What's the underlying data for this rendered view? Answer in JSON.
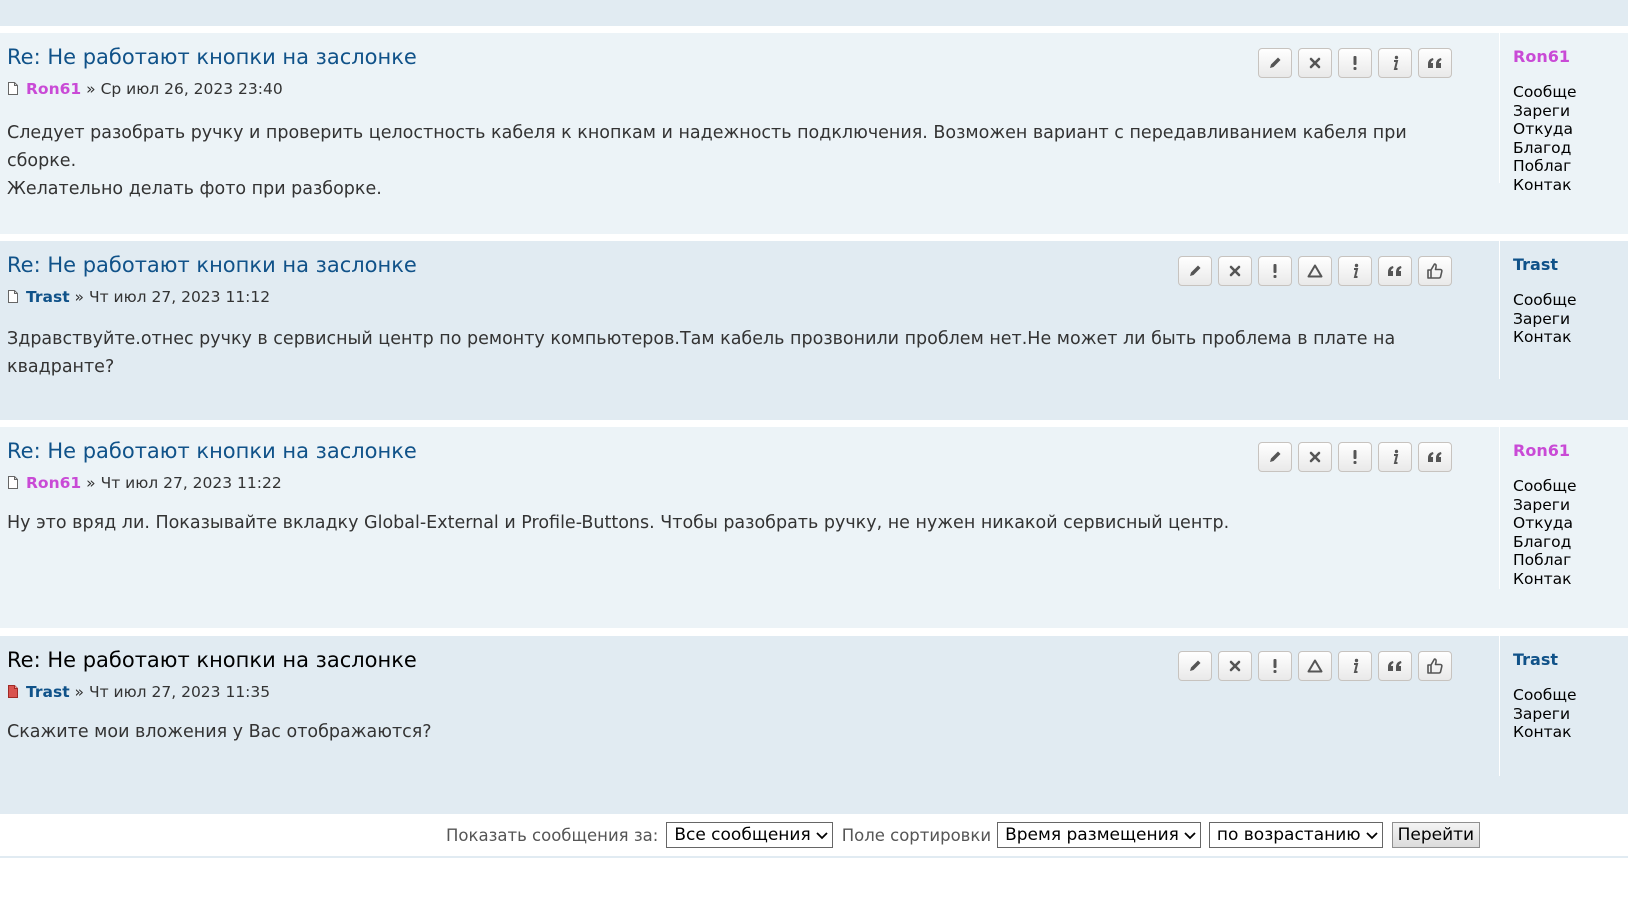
{
  "posts": [
    {
      "title": "Re: Не работают кнопки на заслонке",
      "author": "Ron61",
      "sep": "»",
      "date": "Ср июл 26, 2023 23:40",
      "body": [
        "Следует разобрать ручку и проверить целостность кабеля к кнопкам и надежность подключения. Возможен вариант с передавливанием кабеля при сборке.",
        "Желательно делать фото при разборке."
      ],
      "profile": {
        "name": "Ron61",
        "lines": [
          "Сообще",
          "Зареги",
          "Откуда",
          "Благод",
          "Поблаг",
          "Контак"
        ]
      }
    },
    {
      "title": "Re: Не работают кнопки на заслонке",
      "author": "Trast",
      "sep": "»",
      "date": "Чт июл 27, 2023 11:12",
      "body": [
        "Здравствуйте.отнес ручку в сервисный центр по ремонту компьютеров.Там кабель прозвонили проблем нет.Не может ли быть проблема в плате на квадранте?"
      ],
      "profile": {
        "name": "Trast",
        "lines": [
          "Сообще",
          "Зареги",
          "Контак"
        ]
      }
    },
    {
      "title": "Re: Не работают кнопки на заслонке",
      "author": "Ron61",
      "sep": "»",
      "date": "Чт июл 27, 2023 11:22",
      "body": [
        "Ну это вряд ли. Показывайте вкладку Global-External и Profile-Buttons. Чтобы разобрать ручку, не нужен никакой сервисный центр."
      ],
      "profile": {
        "name": "Ron61",
        "lines": [
          "Сообще",
          "Зареги",
          "Откуда",
          "Благод",
          "Поблаг",
          "Контак"
        ]
      }
    },
    {
      "title": "Re: Не работают кнопки на заслонке",
      "author": "Trast",
      "sep": "»",
      "date": "Чт июл 27, 2023 11:35",
      "body": [
        "Скажите мои вложения у Вас отображаются?"
      ],
      "profile": {
        "name": "Trast",
        "lines": [
          "Сообще",
          "Зареги",
          "Контак"
        ]
      }
    }
  ],
  "sort": {
    "show_label": "Показать сообщения за:",
    "show_value": "Все сообщения",
    "sort_label": "Поле сортировки",
    "sort_value": "Время размещения",
    "order_value": "по возрастанию",
    "go_label": "Перейти"
  },
  "icons": {
    "edit": "pencil-icon",
    "delete": "delete-icon",
    "report": "report-icon",
    "warn": "warning-icon",
    "info": "info-icon",
    "quote": "quote-icon",
    "like": "thumbs-up-icon"
  },
  "colors": {
    "title": "#105289",
    "moderator": "#c94ad6",
    "user": "#105289",
    "post_light": "#ecf3f7",
    "post_dark": "#e1ebf2"
  }
}
